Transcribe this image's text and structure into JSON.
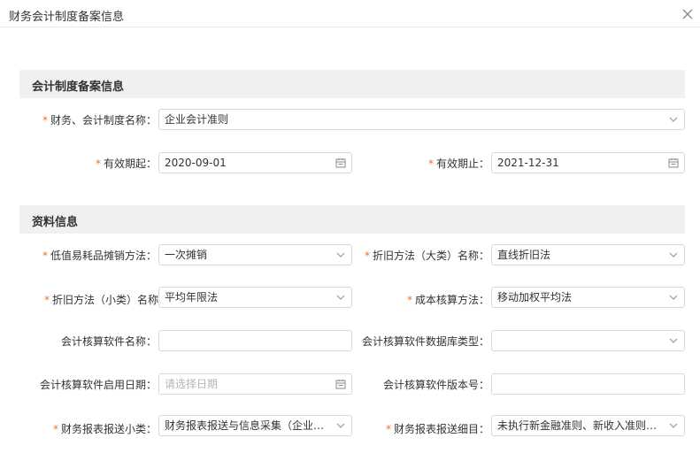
{
  "dialog": {
    "title": "财务会计制度备案信息"
  },
  "sections": {
    "accounting": "会计制度备案信息",
    "materials": "资料信息"
  },
  "fields": {
    "system_name": {
      "label": "财务、会计制度名称：",
      "value": "企业会计准则"
    },
    "valid_from": {
      "label": "有效期起：",
      "value": "2020-09-01"
    },
    "valid_to": {
      "label": "有效期止：",
      "value": "2021-12-31"
    },
    "low_value_method": {
      "label": "低值易耗品摊销方法：",
      "value": "一次摊销"
    },
    "depr_major": {
      "label": "折旧方法（大类）名称：",
      "value": "直线折旧法"
    },
    "depr_minor": {
      "label": "折旧方法（小类）名称",
      "value": "平均年限法"
    },
    "cost_method": {
      "label": "成本核算方法：",
      "value": "移动加权平均法"
    },
    "software_name": {
      "label": "会计核算软件名称：",
      "value": ""
    },
    "db_type": {
      "label": "会计核算软件数据库类型：",
      "value": ""
    },
    "enable_date": {
      "label": "会计核算软件启用日期：",
      "placeholder": "请选择日期"
    },
    "version": {
      "label": "会计核算软件版本号：",
      "value": ""
    },
    "report_class": {
      "label": "财务报表报送小类：",
      "value": "财务报表报送与信息采集（企业会计准则）"
    },
    "report_detail": {
      "label": "财务报表报送细目：",
      "value": "未执行新金融准则、新收入准则和新租赁准则"
    }
  },
  "icons": {
    "close": "close-icon",
    "dropdown": "chevron-down-icon",
    "calendar": "calendar-icon"
  },
  "colors": {
    "required": "#f56c2d",
    "section_bg": "#f0f0f0",
    "border": "#d9d9d9"
  }
}
